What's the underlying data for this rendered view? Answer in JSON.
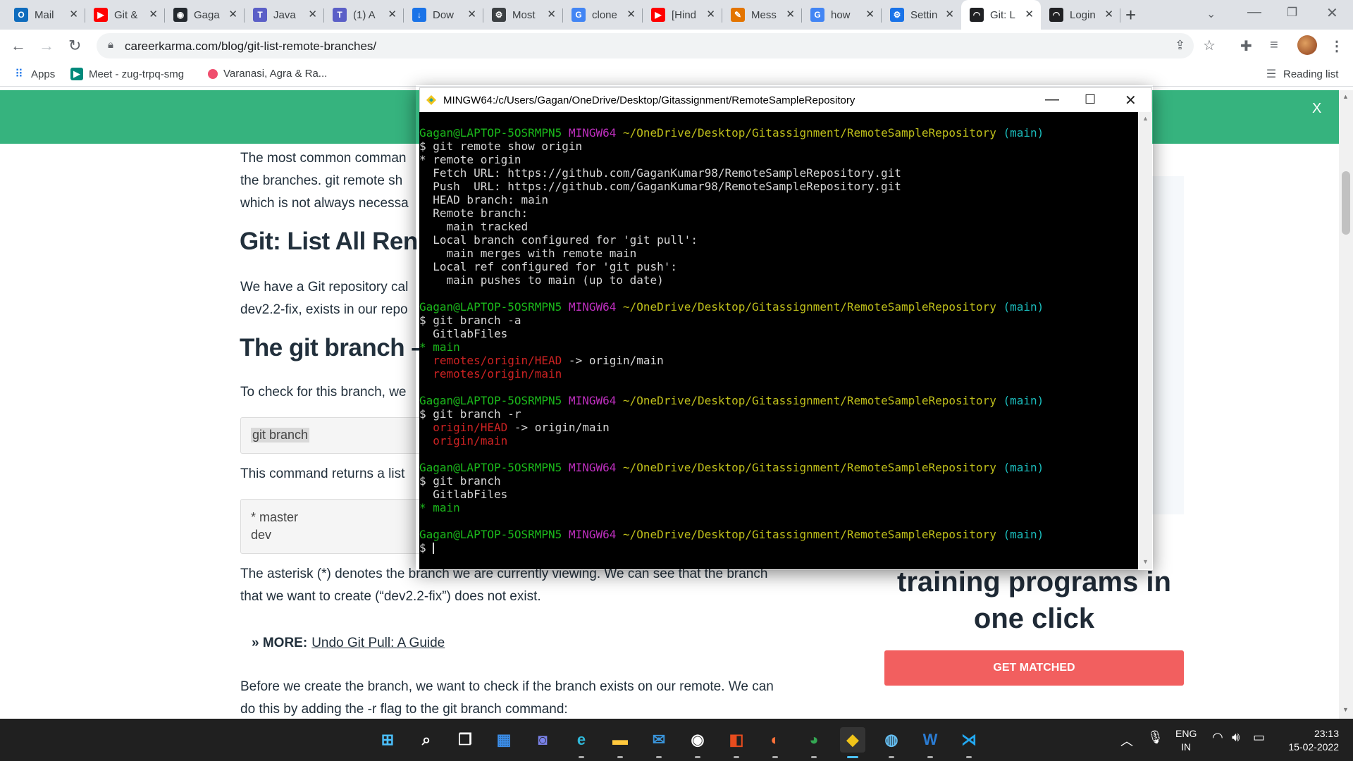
{
  "browser": {
    "tabs": [
      {
        "label": "Mail",
        "icon": "outlook-icon",
        "color": "#0f6cbd",
        "glyph": "O"
      },
      {
        "label": "Git &",
        "icon": "youtube-icon",
        "color": "#ff0000",
        "glyph": "▶"
      },
      {
        "label": "Gaga",
        "icon": "github-icon",
        "color": "#24292e",
        "glyph": "◉"
      },
      {
        "label": "Java",
        "icon": "teams-icon",
        "color": "#5b5fc7",
        "glyph": "T"
      },
      {
        "label": "(1) A",
        "icon": "teams-icon",
        "color": "#5b5fc7",
        "glyph": "T"
      },
      {
        "label": "Dow",
        "icon": "download-icon",
        "color": "#1a73e8",
        "glyph": "↓"
      },
      {
        "label": "Most",
        "icon": "gear-icon",
        "color": "#3c4043",
        "glyph": "⚙"
      },
      {
        "label": "clone",
        "icon": "google-icon",
        "color": "#4285f4",
        "glyph": "G"
      },
      {
        "label": "[Hind",
        "icon": "youtube-icon",
        "color": "#ff0000",
        "glyph": "▶"
      },
      {
        "label": "Mess",
        "icon": "messenger-icon",
        "color": "#e37400",
        "glyph": "✎"
      },
      {
        "label": "how",
        "icon": "google-icon",
        "color": "#4285f4",
        "glyph": "G"
      },
      {
        "label": "Settin",
        "icon": "settings-icon",
        "color": "#1a73e8",
        "glyph": "⚙"
      },
      {
        "label": "Git: L",
        "icon": "careerkarma-icon",
        "color": "#202124",
        "glyph": "◠"
      },
      {
        "label": "Login",
        "icon": "careerkarma-icon",
        "color": "#202124",
        "glyph": "◠"
      }
    ],
    "url": "careerkarma.com/blog/git-list-remote-branches/",
    "bookmarks": [
      {
        "label": "Apps",
        "icon": "apps-grid-icon"
      },
      {
        "label": "Meet - zug-trpq-smg",
        "icon": "google-meet-icon"
      },
      {
        "label": "Varanasi, Agra & Ra...",
        "icon": "bookmark-favicon-icon"
      }
    ],
    "reading_list": "Reading list"
  },
  "page": {
    "banner_close": "X",
    "article": {
      "p1": [
        "The most common comman",
        "the branches. git remote sh",
        "which is not always necessa"
      ],
      "h_list": "Git: List All Ren",
      "p2": [
        "We have a Git repository cal",
        "dev2.2-fix, exists in our repo"
      ],
      "h_branch": "The git branch –",
      "p3": "To check for this branch, we",
      "code1": "git branch",
      "p4": "This command returns a list",
      "code2": [
        "* master",
        "dev"
      ],
      "p5": [
        "The asterisk (*) denotes the branch we are currently viewing. We can see that the branch",
        "that we want to create (“dev2.2-fix”) does not exist."
      ],
      "more_prefix": "» MORE:",
      "more_link": "Undo Git Pull: A Guide",
      "p6": [
        "Before we create the branch, we want to check if the branch exists on our remote. We can",
        "do this by adding the -r flag to the git branch command:"
      ]
    },
    "promo": {
      "title_line1": "training programs in",
      "title_line2": "one click",
      "button": "GET MATCHED"
    }
  },
  "terminal": {
    "title": "MINGW64:/c/Users/Gagan/OneDrive/Desktop/Gitassignment/RemoteSampleRepository",
    "prompt_user": "Gagan@LAPTOP-5OSRMPN5",
    "prompt_env": "MINGW64",
    "prompt_path": "~/OneDrive/Desktop/Gitassignment/RemoteSampleRepository",
    "prompt_branch": "(main)",
    "blocks": [
      {
        "command": "$ git remote show origin",
        "output": [
          {
            "text": "* remote origin",
            "color": "white"
          },
          {
            "text": "  Fetch URL: https://github.com/GaganKumar98/RemoteSampleRepository.git",
            "color": "white"
          },
          {
            "text": "  Push  URL: https://github.com/GaganKumar98/RemoteSampleRepository.git",
            "color": "white"
          },
          {
            "text": "  HEAD branch: main",
            "color": "white"
          },
          {
            "text": "  Remote branch:",
            "color": "white"
          },
          {
            "text": "    main tracked",
            "color": "white"
          },
          {
            "text": "  Local branch configured for 'git pull':",
            "color": "white"
          },
          {
            "text": "    main merges with remote main",
            "color": "white"
          },
          {
            "text": "  Local ref configured for 'git push':",
            "color": "white"
          },
          {
            "text": "    main pushes to main (up to date)",
            "color": "white"
          }
        ]
      },
      {
        "command": "$ git branch -a",
        "output": [
          {
            "text": "  GitlabFiles",
            "color": "white"
          },
          {
            "text": "* main",
            "color": "green"
          },
          {
            "text": "  remotes/origin/HEAD",
            "color": "red",
            "suffix": " -> origin/main"
          },
          {
            "text": "  remotes/origin/main",
            "color": "red"
          }
        ]
      },
      {
        "command": "$ git branch -r",
        "output": [
          {
            "text": "  origin/HEAD",
            "color": "red",
            "suffix": " -> origin/main"
          },
          {
            "text": "  origin/main",
            "color": "red"
          }
        ]
      },
      {
        "command": "$ git branch",
        "output": [
          {
            "text": "  GitlabFiles",
            "color": "white"
          },
          {
            "text": "* main",
            "color": "green"
          }
        ]
      }
    ],
    "final_prompt": "$ "
  },
  "taskbar": {
    "apps": [
      {
        "name": "windows-start-icon",
        "glyph": "⊞",
        "color": "#4cc2ff"
      },
      {
        "name": "search-icon",
        "glyph": "⌕",
        "color": "#ffffff"
      },
      {
        "name": "task-view-icon",
        "glyph": "❐",
        "color": "#ffffff"
      },
      {
        "name": "widgets-icon",
        "glyph": "▦",
        "color": "#3b8eea"
      },
      {
        "name": "teams-chat-icon",
        "glyph": "◙",
        "color": "#7b83eb"
      },
      {
        "name": "edge-icon",
        "glyph": "e",
        "color": "#2fb7d8"
      },
      {
        "name": "file-explorer-icon",
        "glyph": "▬",
        "color": "#ffc83d"
      },
      {
        "name": "mail-icon",
        "glyph": "✉",
        "color": "#3a96dd"
      },
      {
        "name": "github-desktop-icon",
        "glyph": "◉",
        "color": "#ffffff"
      },
      {
        "name": "office-icon",
        "glyph": "◧",
        "color": "#e74c1e"
      },
      {
        "name": "firefox-icon",
        "glyph": "◐",
        "color": "#ff7139"
      },
      {
        "name": "chrome-icon",
        "glyph": "◕",
        "color": "#34a853"
      },
      {
        "name": "git-bash-icon",
        "glyph": "◆",
        "color": "#f0c419"
      },
      {
        "name": "steam-icon",
        "glyph": "◍",
        "color": "#66c0f4"
      },
      {
        "name": "word-icon",
        "glyph": "W",
        "color": "#2b7cd3"
      },
      {
        "name": "vscode-icon",
        "glyph": "⋊",
        "color": "#23a9f2"
      }
    ],
    "lang_line1": "ENG",
    "lang_line2": "IN",
    "time": "23:13",
    "date": "15-02-2022"
  }
}
